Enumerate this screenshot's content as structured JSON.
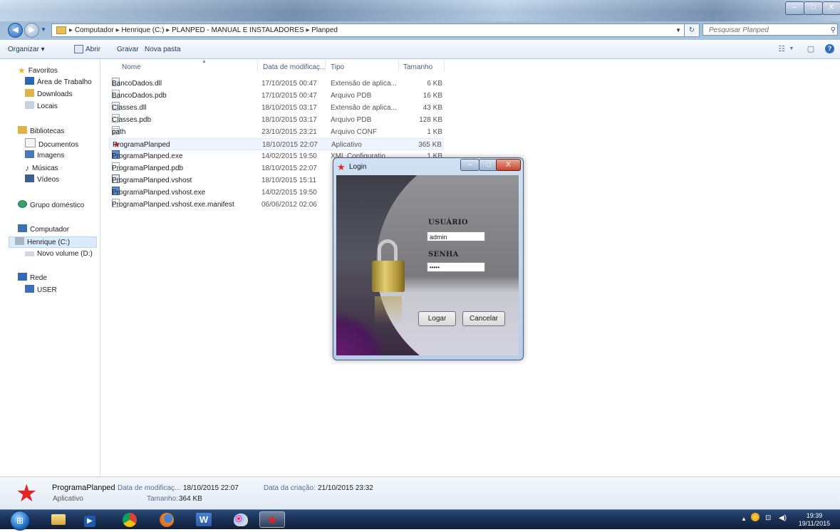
{
  "window": {
    "address_path": [
      "Computador",
      "Henrique (C:)",
      "PLANPED - MANUAL E INSTALADORES",
      "Planped"
    ],
    "search_placeholder": "Pesquisar Planped",
    "min_glyph": "–",
    "max_glyph": "□",
    "close_glyph": "X"
  },
  "toolbar": {
    "organize": "Organizar ▾",
    "open": "Abrir",
    "burn": "Gravar",
    "new_folder": "Nova pasta"
  },
  "sidebar": {
    "favorites": "Favoritos",
    "fav_items": [
      "Área de Trabalho",
      "Downloads",
      "Locais"
    ],
    "libraries": "Bibliotecas",
    "lib_items": [
      "Documentos",
      "Imagens",
      "Músicas",
      "Vídeos"
    ],
    "homegroup": "Grupo doméstico",
    "computer": "Computador",
    "computer_items": [
      "Henrique (C:)",
      "Novo volume (D:)"
    ],
    "network": "Rede",
    "network_items": [
      "USER"
    ]
  },
  "columns": {
    "name": "Nome",
    "modified": "Data de modificaç...",
    "type": "Tipo",
    "size": "Tamanho"
  },
  "files": [
    {
      "name": "BancoDados.dll",
      "modified": "17/10/2015 00:47",
      "type": "Extensão de aplica...",
      "size": "6 KB"
    },
    {
      "name": "BancoDados.pdb",
      "modified": "17/10/2015 00:47",
      "type": "Arquivo PDB",
      "size": "16 KB"
    },
    {
      "name": "Classes.dll",
      "modified": "18/10/2015 03:17",
      "type": "Extensão de aplica...",
      "size": "43 KB"
    },
    {
      "name": "Classes.pdb",
      "modified": "18/10/2015 03:17",
      "type": "Arquivo PDB",
      "size": "128 KB"
    },
    {
      "name": "path",
      "modified": "23/10/2015 23:21",
      "type": "Arquivo CONF",
      "size": "1 KB"
    },
    {
      "name": "ProgramaPlanped",
      "modified": "18/10/2015 22:07",
      "type": "Aplicativo",
      "size": "365 KB"
    },
    {
      "name": "ProgramaPlanped.exe",
      "modified": "14/02/2015 19:50",
      "type": "XML Configuratio...",
      "size": "1 KB"
    },
    {
      "name": "ProgramaPlanped.pdb",
      "modified": "18/10/2015 22:07",
      "type": "",
      "size": ""
    },
    {
      "name": "ProgramaPlanped.vshost",
      "modified": "18/10/2015 15:11",
      "type": "",
      "size": ""
    },
    {
      "name": "ProgramaPlanped.vshost.exe",
      "modified": "14/02/2015 19:50",
      "type": "",
      "size": ""
    },
    {
      "name": "ProgramaPlanped.vshost.exe.manifest",
      "modified": "06/06/2012 02:06",
      "type": "",
      "size": ""
    }
  ],
  "login": {
    "title": "Login",
    "user_label": "USUÁRIO",
    "user_value": "admin",
    "pass_label": "SENHA",
    "pass_value": "•••••",
    "login_button": "Logar",
    "cancel_button": "Cancelar"
  },
  "details": {
    "name": "ProgramaPlanped",
    "type": "Aplicativo",
    "modified_label": "Data de modificaç...",
    "modified_value": "18/10/2015 22:07",
    "size_label": "Tamanho:",
    "size_value": "364 KB",
    "created_label": "Data da criação:",
    "created_value": "21/10/2015 23:32"
  },
  "taskbar": {
    "clock_time": "19:39",
    "clock_date": "19/11/2015"
  }
}
